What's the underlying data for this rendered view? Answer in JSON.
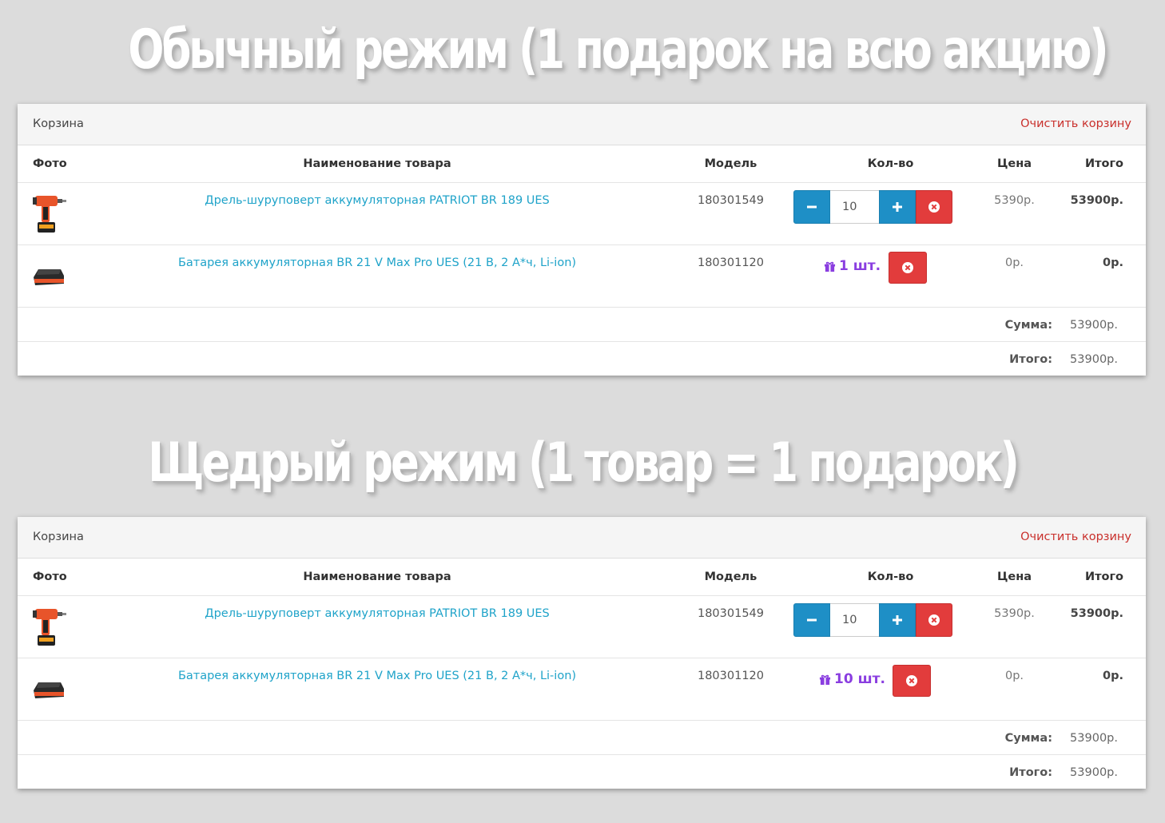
{
  "headings": {
    "normal": "Обычный режим (1 подарок на всю акцию)",
    "generous": "Щедрый режим (1  товар = 1 подарок)"
  },
  "carts": [
    {
      "title": "Корзина",
      "clear_label": "Очистить корзину",
      "columns": [
        "Фото",
        "Наименование товара",
        "Модель",
        "Кол-во",
        "Цена",
        "Итого"
      ],
      "items": [
        {
          "name": "Дрель-шуруповерт аккумуляторная PATRIOT BR 189 UES",
          "model": "180301549",
          "quantity": "10",
          "price": "5390р.",
          "total": "53900р."
        },
        {
          "name": "Батарея аккумуляторная BR 21 V Max Pro UES (21 В, 2 А*ч, Li-ion)",
          "model": "180301120",
          "gift_qty": "1 шт.",
          "price": "0р.",
          "total": "0р."
        }
      ],
      "sum_label": "Сумма:",
      "sum_value": "53900р.",
      "total_label": "Итого:",
      "total_value": "53900р."
    },
    {
      "title": "Корзина",
      "clear_label": "Очистить корзину",
      "columns": [
        "Фото",
        "Наименование товара",
        "Модель",
        "Кол-во",
        "Цена",
        "Итого"
      ],
      "items": [
        {
          "name": "Дрель-шуруповерт аккумуляторная PATRIOT BR 189 UES",
          "model": "180301549",
          "quantity": "10",
          "price": "5390р.",
          "total": "53900р."
        },
        {
          "name": "Батарея аккумуляторная BR 21 V Max Pro UES (21 В, 2 А*ч, Li-ion)",
          "model": "180301120",
          "gift_qty": "10 шт.",
          "price": "0р.",
          "total": "0р."
        }
      ],
      "sum_label": "Сумма:",
      "sum_value": "53900р.",
      "total_label": "Итого:",
      "total_value": "53900р."
    }
  ],
  "icons": {
    "minus": "minus-icon",
    "plus": "plus-icon",
    "remove": "remove-circle-icon",
    "gift": "gift-icon"
  },
  "colors": {
    "link": "#1fa3c9",
    "clear": "#c9302c",
    "blue_button": "#1e8fc6",
    "red_button": "#e23c3c",
    "gift": "#8a3ee0"
  }
}
